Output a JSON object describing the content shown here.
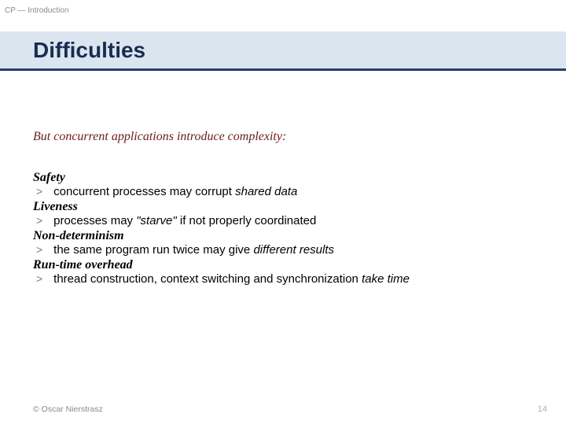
{
  "header": {
    "topLabel": "CP — Introduction"
  },
  "title": "Difficulties",
  "intro": "But concurrent applications introduce complexity:",
  "sections": [
    {
      "head": "Safety",
      "bullet_pre": "concurrent processes may corrupt ",
      "bullet_em": "shared data",
      "bullet_post": ""
    },
    {
      "head": "Liveness",
      "bullet_pre": "processes may ",
      "bullet_em": "\"starve\"",
      "bullet_post": " if not properly coordinated"
    },
    {
      "head": "Non-determinism",
      "bullet_pre": "the same program run twice may give ",
      "bullet_em": "different results",
      "bullet_post": ""
    },
    {
      "head": "Run-time overhead",
      "bullet_pre": "thread construction, context switching and synchronization ",
      "bullet_em": "take time",
      "bullet_post": ""
    }
  ],
  "footer": {
    "copyright": "© Oscar Nierstrasz",
    "page": "14"
  },
  "glyphs": {
    "arrow": ">"
  }
}
